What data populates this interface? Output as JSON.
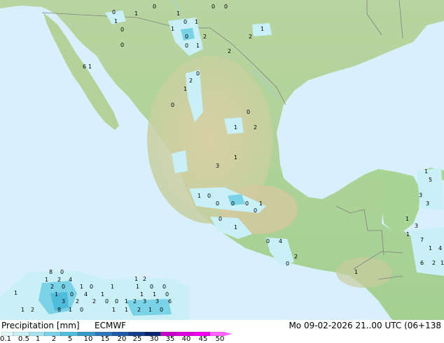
{
  "title": "Precipitation [mm]",
  "source": "ECMWF",
  "valid_time": "Mo 09-02-2026 21..00 UTC (06+138",
  "legend": {
    "ticks": [
      "0.1",
      "0.5",
      "1",
      "2",
      "5",
      "10",
      "15",
      "20",
      "25",
      "30",
      "35",
      "40",
      "45",
      "50"
    ],
    "colors": [
      "#e4f8fb",
      "#c8f0f6",
      "#a4e4f0",
      "#7ad2e6",
      "#50bcdc",
      "#3898cc",
      "#2c78bc",
      "#1e5aa8",
      "#143c8c",
      "#0a2474",
      "#c800c8",
      "#dc00dc",
      "#f000f0",
      "#ff64ff"
    ]
  },
  "colors": {
    "ocean": "#d8f0fc",
    "land_low": "#a8d496",
    "land_high": "#d8c8a0",
    "border": "#808080",
    "rain_light": "#c8f0f6",
    "rain_medium": "#7ad2e6",
    "rain_heavy": "#3898cc"
  },
  "point_values": [
    "0",
    "1",
    "0",
    "1",
    "0",
    "0",
    "1",
    "0",
    "1",
    "0",
    "1",
    "1",
    "2",
    "0",
    "2",
    "0",
    "1",
    "0",
    "2",
    "0",
    "1",
    "2",
    "6",
    "1",
    "0",
    "0",
    "1",
    "2",
    "3",
    "1",
    "0",
    "1",
    "0",
    "0",
    "0",
    "1",
    "0",
    "1",
    "0",
    "0",
    "4",
    "0",
    "2",
    "1",
    "1",
    "3",
    "1",
    "7",
    "1",
    "4",
    "6",
    "2",
    "1",
    "1",
    "5",
    "3",
    "3",
    "8",
    "0",
    "1",
    "2",
    "4",
    "2",
    "0",
    "1",
    "0",
    "1",
    "0",
    "4",
    "1",
    "1",
    "3",
    "2",
    "2",
    "0",
    "0",
    "1",
    "2",
    "3",
    "3",
    "6",
    "1",
    "2",
    "8",
    "1",
    "0",
    "1",
    "1",
    "2",
    "1",
    "0",
    "1",
    "2",
    "1",
    "0",
    "0",
    "1",
    "1",
    "1",
    "0"
  ]
}
